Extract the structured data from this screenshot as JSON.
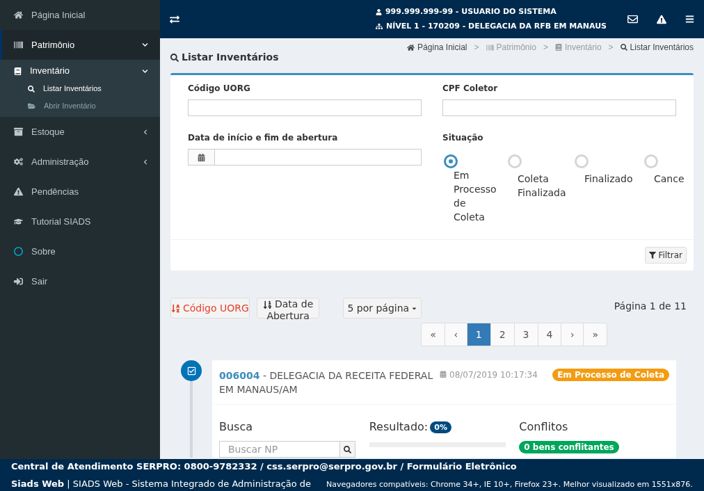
{
  "sidebar": {
    "items": [
      {
        "label": "Página Inicial",
        "kind": "link",
        "selected": false
      },
      {
        "label": "Patrimônio",
        "kind": "menu",
        "selected": true,
        "expanded": true,
        "children": [
          {
            "label": "Inventário",
            "expanded": true,
            "children": [
              {
                "label": "Listar Inventários",
                "selected": true
              },
              {
                "label": "Abrir Inventário",
                "selected": false
              }
            ]
          }
        ]
      },
      {
        "label": "Estoque",
        "kind": "menu",
        "selected": false,
        "expanded": false
      },
      {
        "label": "Administração",
        "kind": "menu",
        "selected": false,
        "expanded": false
      },
      {
        "label": "Pendências",
        "kind": "link",
        "selected": false
      },
      {
        "label": "Tutorial SIADS",
        "kind": "link",
        "selected": false
      },
      {
        "label": "Sobre",
        "kind": "link",
        "selected": false
      },
      {
        "label": "Sair",
        "kind": "link",
        "selected": false
      }
    ]
  },
  "header": {
    "user": "999.999.999-99 - USUARIO DO SISTEMA",
    "unit": "NÍVEL 1 - 170209 - DELEGACIA DA RFB EM MANAUS"
  },
  "page_title": "Listar Inventários",
  "breadcrumbs": [
    {
      "label": "Página Inicial",
      "disabled": false
    },
    {
      "label": "Patrimônio",
      "disabled": true
    },
    {
      "label": "Inventário",
      "disabled": true
    },
    {
      "label": "Listar Inventários",
      "disabled": false
    }
  ],
  "breadcrumb_separator": ">",
  "filter": {
    "codigo_uorg": {
      "label": "Código UORG"
    },
    "cpf_coletor": {
      "label": "CPF Coletor"
    },
    "data": {
      "label": "Data de início e fim de abertura"
    },
    "situacao": {
      "label": "Situação",
      "options": [
        {
          "label": "Em Processo de Coleta",
          "selected": true
        },
        {
          "label": "Coleta Finalizada",
          "selected": false
        },
        {
          "label": "Finalizado",
          "selected": false
        },
        {
          "label": "Cance",
          "selected": false
        }
      ]
    },
    "button": "Filtrar"
  },
  "sort_buttons": [
    {
      "label": "Código UORG",
      "selected": true
    },
    {
      "label": "Data de Abertura",
      "selected": false
    }
  ],
  "per_page": "5 por página",
  "page_info": "Página 1 de 11",
  "pagination": [
    {
      "label": "«",
      "selected": false
    },
    {
      "label": "‹",
      "selected": false
    },
    {
      "label": "1",
      "selected": true
    },
    {
      "label": "2",
      "selected": false
    },
    {
      "label": "3",
      "selected": false
    },
    {
      "label": "4",
      "selected": false
    },
    {
      "label": "›",
      "selected": false
    },
    {
      "label": "»",
      "selected": false
    }
  ],
  "inventories": [
    {
      "code": "006004",
      "name": " - DELEGACIA DA RECEITA FEDERAL EM MANAUS/AM",
      "date": "08/07/2019 10:17:34",
      "status": "Em Processo de Coleta",
      "busca_label": "Busca",
      "busca_placeholder": "Buscar NP",
      "resultado_label": "Resultado:",
      "resultado_badge": "0%",
      "level": 0,
      "conflitos_label": "Conflitos",
      "conflitos_badge": "0 bens conflitantes"
    }
  ],
  "footer": {
    "line1": "Central de Atendimento SERPRO: 0800-9782332 / css.serpro@serpro.gov.br / Formulário Eletrônico",
    "line2": "**Siads Web** | SIADS Web - Sistema Integrado de Administração de",
    "browsers": "Navegadores compatíveis: Chrome 34+, IE 10+, Firefox 23+. Melhor visualizado em 1551x876."
  }
}
